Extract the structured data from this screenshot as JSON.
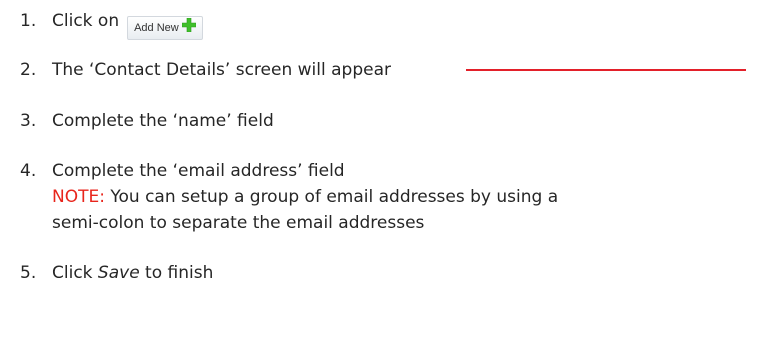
{
  "steps": [
    {
      "number": "1.",
      "text": "Click on",
      "button_label": "Add New"
    },
    {
      "number": "2.",
      "text": "The ‘Contact Details’ screen will appear"
    },
    {
      "number": "3.",
      "text": "Complete the ‘name’ field"
    },
    {
      "number": "4.",
      "text": "Complete the ‘email address’ field",
      "note_label": "NOTE:",
      "note_text": " You can setup a group of email addresses by using a",
      "note_text_2": "semi-colon to separate the email addresses"
    },
    {
      "number": "5.",
      "text_before": "Click ",
      "emphasis": "Save",
      "text_after": " to finish"
    }
  ],
  "colors": {
    "body_text": "#262626",
    "note": "#e8251c",
    "pointer_line": "#e3202a",
    "plus_icon": "#3fbf2a"
  },
  "icons": {
    "add_button_icon": "green-plus-icon"
  }
}
